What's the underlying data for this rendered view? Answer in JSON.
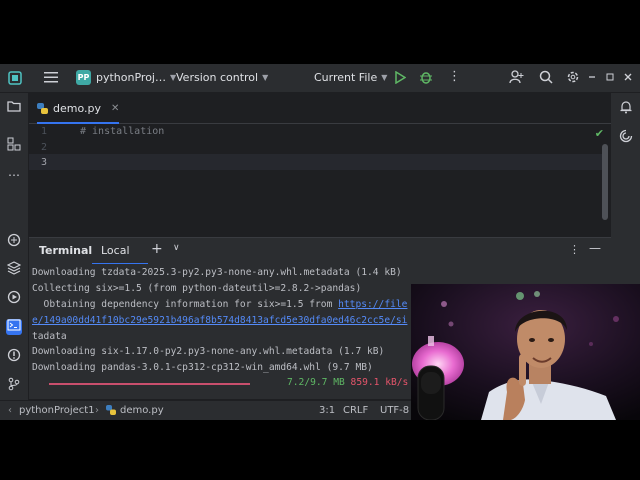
{
  "toolbar": {
    "project_badge": "PP",
    "project_name": "pythonProj…",
    "vcs_label": "Version control",
    "run_config": "Current File"
  },
  "editor": {
    "tab_label": "demo.py",
    "lines": [
      {
        "number": "1",
        "text": "# installation"
      },
      {
        "number": "2",
        "text": ""
      },
      {
        "number": "3",
        "text": ""
      }
    ]
  },
  "terminal": {
    "title": "Terminal",
    "tab_label": "Local",
    "lines": [
      "  Downloading tzdata-2025.3-py2.py3-none-any.whl.metadata (1.4 kB)",
      "Collecting six>=1.5 (from python-dateutil>=2.8.2->pandas)",
      "  Obtaining dependency information for six>=1.5 from ",
      "",
      "tadata",
      "  Downloading six-1.17.0-py2.py3-none-any.whl.metadata (1.7 kB)",
      "Downloading pandas-3.0.1-cp312-cp312-win_amd64.whl (9.7 MB)"
    ],
    "link_part1": "https://file",
    "link_part2": "e/149a00dd41f10bc29e5921b496af8b574d8413afcd5e30dfa0ed46c2cc5e/si",
    "progress_size": "7.2/9.7 MB",
    "progress_speed": "859.1 kB/s",
    "progress_fraction": 0.74
  },
  "status": {
    "breadcrumb_project": "pythonProject1",
    "breadcrumb_file": "demo.py",
    "caret_position": "3:1",
    "line_separator": "CRLF",
    "encoding": "UTF-8"
  },
  "colors": {
    "accent": "#3574f0",
    "progress": "#c94f6d",
    "size_green": "#5fb865",
    "speed_red": "#e5556b",
    "link": "#548af7"
  }
}
